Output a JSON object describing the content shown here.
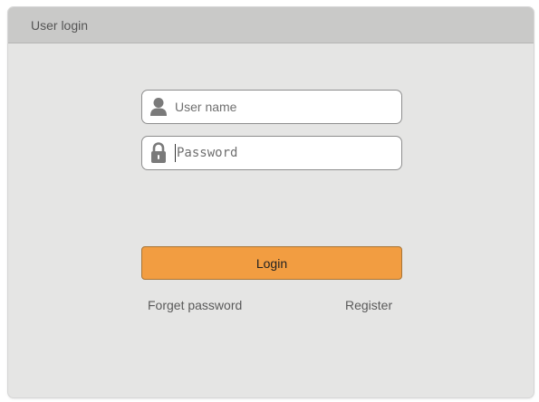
{
  "window": {
    "title": "User login"
  },
  "form": {
    "username": {
      "placeholder": "User name",
      "value": "",
      "icon": "user-icon"
    },
    "password": {
      "placeholder": "Password",
      "value": "",
      "icon": "lock-icon"
    },
    "login_label": "Login",
    "forget_label": "Forget password",
    "register_label": "Register"
  },
  "colors": {
    "accent": "#f29d41",
    "titlebar": "#c9c9c8",
    "background": "#e5e5e4"
  }
}
